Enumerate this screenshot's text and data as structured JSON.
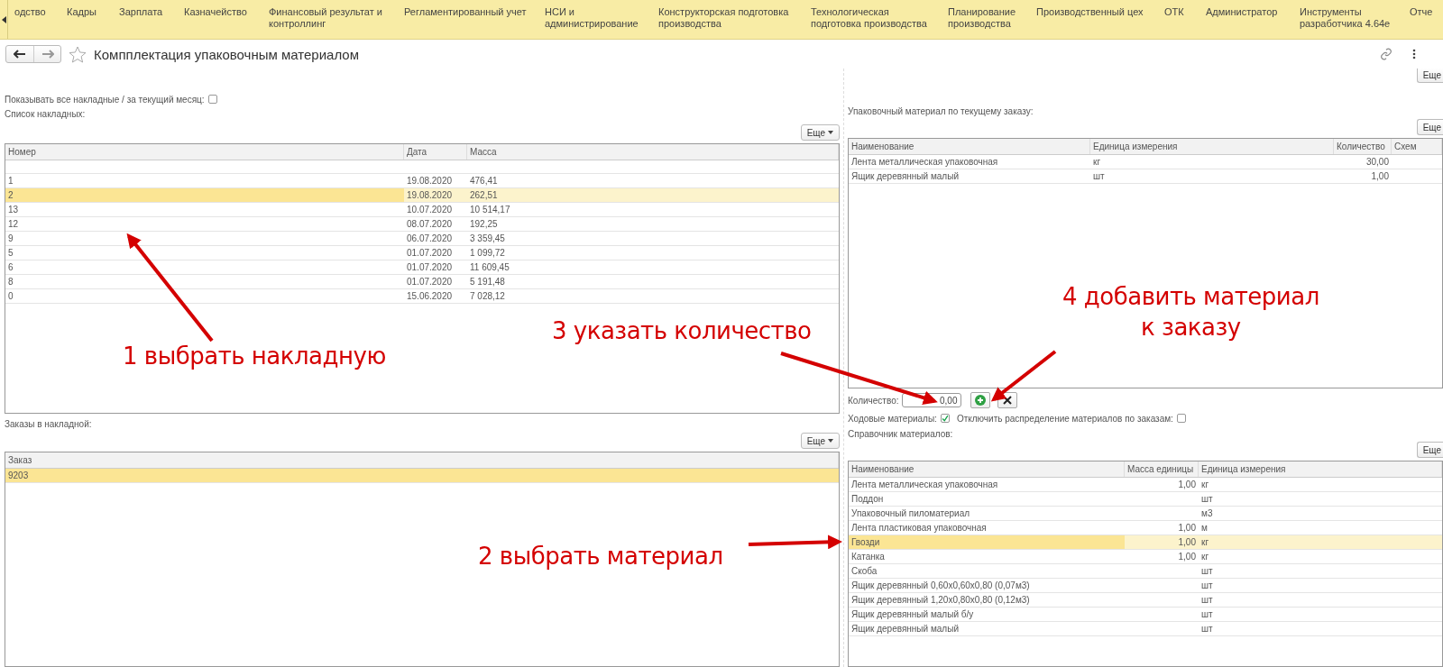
{
  "nav": {
    "items": [
      {
        "label": "одство"
      },
      {
        "label": "Кадры"
      },
      {
        "label": "Зарплата"
      },
      {
        "label": "Казначейство"
      },
      {
        "label": "Финансовый результат и контроллинг"
      },
      {
        "label": "Регламентированный учет"
      },
      {
        "label": "НСИ и администрирование"
      },
      {
        "label": "Конструкторская подготовка производства"
      },
      {
        "label": "Технологическая подготовка производства"
      },
      {
        "label": "Планирование производства"
      },
      {
        "label": "Производственный цех"
      },
      {
        "label": "ОТК"
      },
      {
        "label": "Администратор"
      },
      {
        "label": "Инструменты разработчика 4.64е"
      },
      {
        "label": "Отче"
      }
    ]
  },
  "window": {
    "title": "Компплектация упаковочным материалом",
    "favorite": false
  },
  "left": {
    "show_all": {
      "label": "Показывать все накладные / за текущий месяц:",
      "checked": false
    },
    "invoices_label": "Список накладных:",
    "more_button": "Еще",
    "invoices": {
      "columns": [
        "Номер",
        "Дата",
        "Масса"
      ],
      "rows": [
        {
          "cells": [
            "1",
            "19.08.2020",
            "476,41"
          ],
          "selected": false
        },
        {
          "cells": [
            "2",
            "19.08.2020",
            "262,51"
          ],
          "selected": true
        },
        {
          "cells": [
            "13",
            "10.07.2020",
            "10 514,17"
          ],
          "selected": false
        },
        {
          "cells": [
            "12",
            "08.07.2020",
            "192,25"
          ],
          "selected": false
        },
        {
          "cells": [
            "9",
            "06.07.2020",
            "3 359,45"
          ],
          "selected": false
        },
        {
          "cells": [
            "5",
            "01.07.2020",
            "1 099,72"
          ],
          "selected": false
        },
        {
          "cells": [
            "6",
            "01.07.2020",
            "11 609,45"
          ],
          "selected": false
        },
        {
          "cells": [
            "8",
            "01.07.2020",
            "5 191,48"
          ],
          "selected": false
        },
        {
          "cells": [
            "0",
            "15.06.2020",
            "7 028,12"
          ],
          "selected": false
        }
      ]
    },
    "orders_label": "Заказы в накладной:",
    "orders_more_button": "Еще",
    "orders": {
      "columns": [
        "Заказ"
      ],
      "rows": [
        {
          "cells": [
            "9203"
          ],
          "selected": true
        }
      ]
    }
  },
  "right": {
    "top_more_button": "Еще",
    "current_label": "Упаковочный материал по текущему заказу:",
    "more_button": "Еще",
    "current": {
      "columns": [
        "Наименование",
        "Единица измерения",
        "Количество",
        "Схем"
      ],
      "rows": [
        {
          "cells": [
            "Лента металлическая упаковочная",
            "кг",
            "30,00",
            ""
          ],
          "selected": false
        },
        {
          "cells": [
            "Ящик деревянный малый",
            "шт",
            "1,00",
            ""
          ],
          "selected": false
        }
      ]
    },
    "quantity": {
      "label": "Количество:",
      "value": "0,00"
    },
    "running": {
      "label": "Ходовые материалы:",
      "checked": true
    },
    "disable_distribution": {
      "label": "Отключить распределение материалов по заказам:",
      "checked": false
    },
    "catalog_label": "Справочник материалов:",
    "catalog_more_button": "Еще",
    "catalog": {
      "columns": [
        "Наименование",
        "Масса единицы",
        "Единица измерения"
      ],
      "rows": [
        {
          "cells": [
            "Лента металлическая упаковочная",
            "1,00",
            "кг"
          ],
          "selected": false
        },
        {
          "cells": [
            "Поддон",
            "",
            "шт"
          ],
          "selected": false
        },
        {
          "cells": [
            "Упаковочный пиломатериал",
            "",
            "м3"
          ],
          "selected": false
        },
        {
          "cells": [
            "Лента пластиковая упаковочная",
            "1,00",
            "м"
          ],
          "selected": false
        },
        {
          "cells": [
            "Гвозди",
            "1,00",
            "кг"
          ],
          "selected": true
        },
        {
          "cells": [
            "Катанка",
            "1,00",
            "кг"
          ],
          "selected": false
        },
        {
          "cells": [
            "Скоба",
            "",
            "шт"
          ],
          "selected": false
        },
        {
          "cells": [
            "Ящик деревянный 0,60х0,60х0,80 (0,07м3)",
            "",
            "шт"
          ],
          "selected": false
        },
        {
          "cells": [
            "Ящик деревянный 1,20х0,80х0,80 (0,12м3)",
            "",
            "шт"
          ],
          "selected": false
        },
        {
          "cells": [
            "Ящик деревянный малый б/у",
            "",
            "шт"
          ],
          "selected": false
        },
        {
          "cells": [
            "Ящик деревянный малый",
            "",
            "шт"
          ],
          "selected": false
        }
      ]
    }
  },
  "annotations": [
    {
      "lines": [
        "1 выбрать накладную"
      ]
    },
    {
      "lines": [
        "2 выбрать материал"
      ]
    },
    {
      "lines": [
        "3 указать количество"
      ]
    },
    {
      "lines": [
        "4 добавить материал",
        "к заказу"
      ]
    }
  ]
}
